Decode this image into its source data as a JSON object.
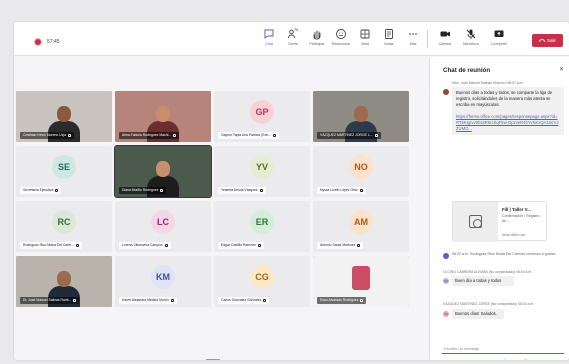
{
  "meeting": {
    "timer": "57:45",
    "colors": {
      "recording": "#c4314b",
      "accent": "#5b5fc7",
      "leave": "#c4314b"
    }
  },
  "toolbar": {
    "buttons": [
      {
        "label": "Chat",
        "icon": "chat-icon",
        "active": true
      },
      {
        "label": "Gente",
        "icon": "people-icon",
        "badge": "70"
      },
      {
        "label": "Participar",
        "icon": "raise-hand-icon"
      },
      {
        "label": "Reaccionar",
        "icon": "smiley-icon"
      },
      {
        "label": "Vista",
        "icon": "view-icon"
      },
      {
        "label": "Notas",
        "icon": "notes-icon"
      },
      {
        "label": "Más",
        "icon": "more-icon"
      }
    ],
    "devices": [
      {
        "label": "Cámara",
        "icon": "camera-icon"
      },
      {
        "label": "Micrófono",
        "icon": "microphone-icon"
      },
      {
        "label": "Compartir",
        "icon": "share-icon"
      }
    ],
    "leave_label": "Salir"
  },
  "participants": [
    {
      "name": "Cristhian Kevin Moreno Uzja",
      "video": true,
      "skin": "#8b5a3c",
      "bg": "#c9c4bf",
      "shirt": "#2b2b2b"
    },
    {
      "name": "Alma Fabiola Rodríguez Machi...",
      "video": true,
      "skin": "#c98e6e",
      "bg": "#b6847a",
      "shirt": "#6a2e2e"
    },
    {
      "initials": "GP",
      "name": "Gaynor Tapia Ana Patricia (Extr...",
      "color": "#f6d2d6",
      "text": "#c4314b"
    },
    {
      "name": "VÁZQUEZ MARTÍNEZ JORGE L...",
      "video": true,
      "skin": "#a26a4c",
      "bg": "#8f8c86",
      "shirt": "#2e3a4a"
    },
    {
      "initials": "SE",
      "name": "Secretaría Ejecutiva",
      "color": "#cfe7e4",
      "text": "#1f6f67"
    },
    {
      "name": "Diana Murillo Rodríguez",
      "video": true,
      "selected": true,
      "skin": "#c7906e",
      "bg": "#4c5a4e",
      "shirt": "#1d1d1d"
    },
    {
      "initials": "YV",
      "name": "Yesenia Arriola Vázquez",
      "color": "#e6ecd1",
      "text": "#5d6b1d"
    },
    {
      "initials": "NO",
      "name": "Nyssa Lizeth López Ortiz",
      "color": "#fbe2cc",
      "text": "#b2571a"
    },
    {
      "initials": "RC",
      "name": "Rodríguez Rico María Del Carm...",
      "color": "#dbe8d7",
      "text": "#3d6b36"
    },
    {
      "initials": "LC",
      "name": "Lorena Villanueva Campos",
      "color": "#f6d6e6",
      "text": "#a0266a"
    },
    {
      "initials": "ER",
      "name": "Edgar Castillo Ramírez",
      "color": "#d5ecd9",
      "text": "#2a7a3f"
    },
    {
      "initials": "AM",
      "name": "Antonio Sandí Martínez",
      "color": "#fbe2cc",
      "text": "#b2571a"
    },
    {
      "name": "Dr. José Manuel Salinas Raml...",
      "video": true,
      "skin": "#9c6a4f",
      "bg": "#b9b3ab",
      "shirt": "#222a3a"
    },
    {
      "initials": "KM",
      "name": "Karen Alejandra Medina Murch",
      "color": "#dfe3f6",
      "text": "#3f4fa8"
    },
    {
      "initials": "CG",
      "name": "Carlos Gonzalez Gonzalez",
      "color": "#fbe8c6",
      "text": "#9b6a12"
    },
    {
      "name": "Esau Alvarado Rodríguez",
      "video": true,
      "skin": "#d9d9d9",
      "bg": "#f2f2f2",
      "shirt": "#c4314b",
      "logo": true
    }
  ],
  "chat": {
    "title": "Chat de reunión",
    "messages": [
      {
        "meta": "Mtro. José Manuel Salinas Guerrero   58:07 a.m.",
        "text": "Buenos días a todas y todos, se comparte la liga de registro, solicitándoles de la manera más atenta se escriba en mayúsculas.",
        "link": "https://forms.office.com/pages/responsepage.aspx?id=RT5KIgrvv0h5sR6rcKqF5w-OpzveR4hYvNKxQA1mrVJZUMO..."
      }
    ],
    "file_card": {
      "title": "Fill | Taller V...",
      "subtitle": "Confirmación / Registro de...",
      "source": "forms.office.com"
    },
    "system_message": "08:22 a.m.   Rodríguez Rico María Del Carmen comenzó a grabar.",
    "replies": [
      {
        "meta": "OLCHIO CABRERA ALEMÁN (No comprobado)   08:04 a.m.",
        "text": "Buen día a todas y todos",
        "initials": "OC"
      },
      {
        "meta": "VÁZQUEZ MARTÍNEZ JORGE (No comprobado)   08:04 a.m.",
        "text": "Buenos días! Saludos.",
        "initials": "VJ"
      }
    ],
    "compose_placeholder": "Escribe un mensaje"
  }
}
